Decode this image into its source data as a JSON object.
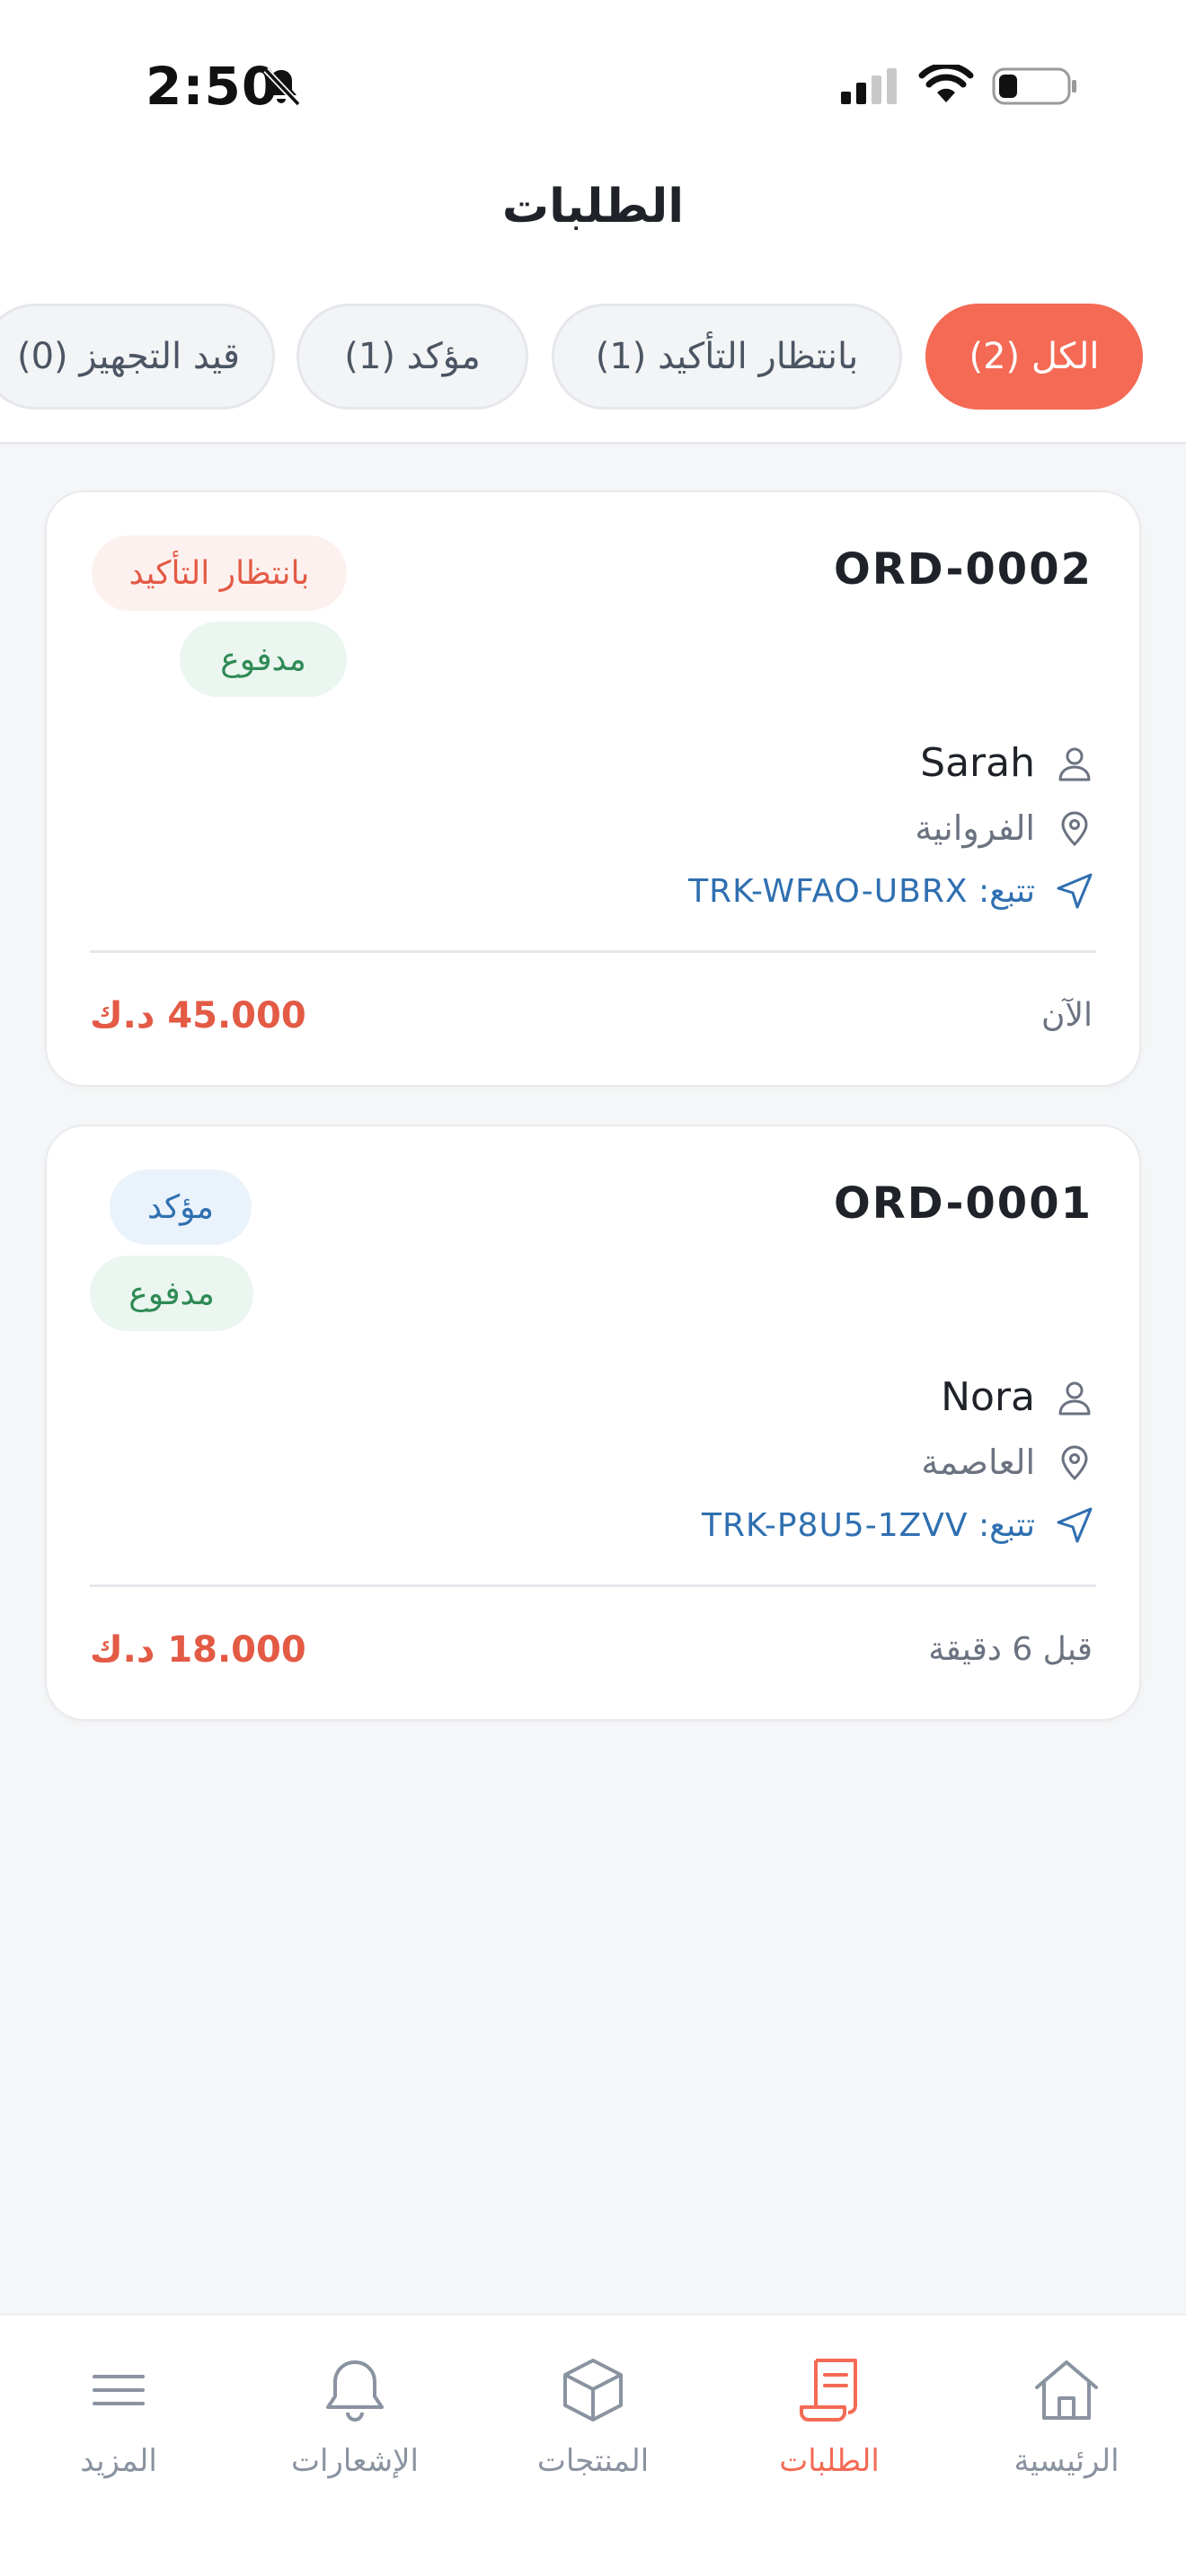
{
  "status_bar": {
    "time": "2:50"
  },
  "header": {
    "title": "الطلبات"
  },
  "tabs": [
    {
      "label": "الكل (2)"
    },
    {
      "label": "بانتظار التأكيد (1)"
    },
    {
      "label": "مؤكد (1)"
    },
    {
      "label": "قيد التجهيز (0)"
    }
  ],
  "orders": [
    {
      "id": "ORD-0002",
      "status": "بانتظار التأكيد",
      "payment": "مدفوع",
      "customer": "Sarah",
      "area": "الفروانية",
      "tracking": "تتبع: TRK-WFAO-UBRX",
      "time": "الآن",
      "amount": "45.000 د.ك"
    },
    {
      "id": "ORD-0001",
      "status": "مؤكد",
      "payment": "مدفوع",
      "customer": "Nora",
      "area": "العاصمة",
      "tracking": "تتبع: TRK-P8U5-1ZVV",
      "time": "قبل 6 دقيقة",
      "amount": "18.000 د.ك"
    }
  ],
  "bottom_nav": {
    "home": "الرئيسية",
    "orders": "الطلبات",
    "products": "المنتجات",
    "notifications": "الإشعارات",
    "more": "المزيد"
  },
  "colors": {
    "accent": "#f46a55",
    "link": "#2f6fb0",
    "paid": "#2f8a55",
    "background": "#f5f6f7"
  }
}
